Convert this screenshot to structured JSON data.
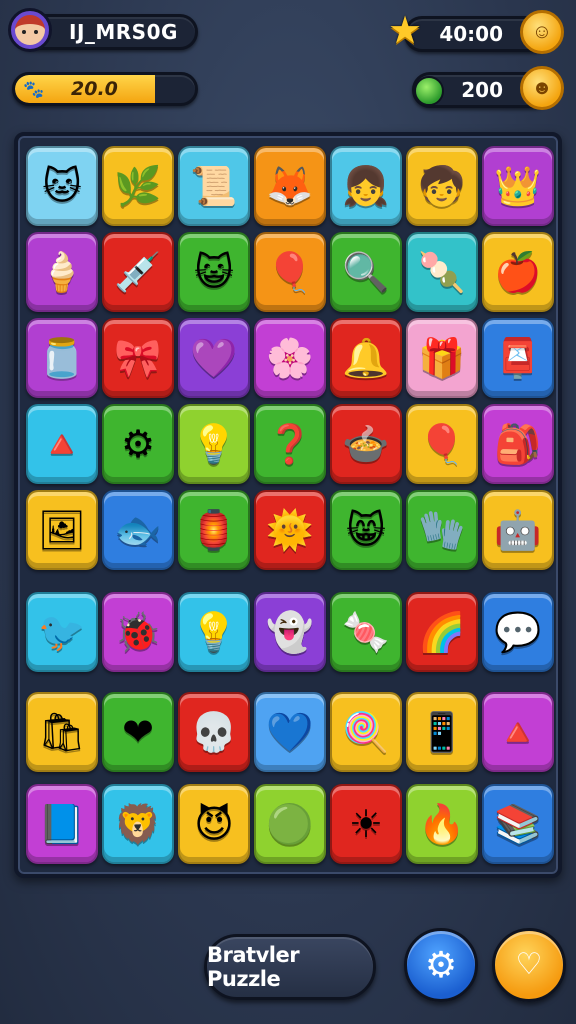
{
  "hud": {
    "player_name": "IJ_MRS0G",
    "energy_value": "20.0",
    "energy_fill": 0.75,
    "coins_value": "40:00",
    "gems_value": "200"
  },
  "footer": {
    "title_button": "Bratvler Puzzle",
    "settings_icon": "gear-icon",
    "hint_icon": "tooth-icon"
  },
  "board": {
    "rows": [
      [
        {
          "name": "tile-cat-king",
          "color": "#7fd3f2",
          "glyph": "🐱"
        },
        {
          "name": "tile-leaf",
          "color": "#f7c01f",
          "glyph": "🌿"
        },
        {
          "name": "tile-scroll",
          "color": "#4fc7e8",
          "glyph": "📜"
        },
        {
          "name": "tile-fox-warrior",
          "color": "#f59416",
          "glyph": "🦊"
        },
        {
          "name": "tile-blonde-girl",
          "color": "#4fc7e8",
          "glyph": "👧"
        },
        {
          "name": "tile-red-hood-girl",
          "color": "#f7c01f",
          "glyph": "🧒"
        },
        {
          "name": "tile-crown",
          "color": "#b13fd1",
          "glyph": "👑"
        }
      ],
      [
        {
          "name": "tile-ice-cream",
          "color": "#b13fd1",
          "glyph": "🍦"
        },
        {
          "name": "tile-syringe",
          "color": "#e0261f",
          "glyph": "💉"
        },
        {
          "name": "tile-red-cat",
          "color": "#3fb52f",
          "glyph": "😺"
        },
        {
          "name": "tile-balloon",
          "color": "#f59416",
          "glyph": "🎈"
        },
        {
          "name": "tile-magnifier",
          "color": "#3fb52f",
          "glyph": "🔍"
        },
        {
          "name": "tile-torch",
          "color": "#33c2c9",
          "glyph": "🍡"
        },
        {
          "name": "tile-apples",
          "color": "#f7c01f",
          "glyph": "🍎"
        }
      ],
      [
        {
          "name": "tile-jar",
          "color": "#b13fd1",
          "glyph": "🫙"
        },
        {
          "name": "tile-balloon-purple",
          "color": "#e0261f",
          "glyph": "🎀"
        },
        {
          "name": "tile-heart-wand",
          "color": "#8b3fd6",
          "glyph": "💜"
        },
        {
          "name": "tile-purple-flower",
          "color": "#c23fd4",
          "glyph": "🌸"
        },
        {
          "name": "tile-lamp",
          "color": "#e0261f",
          "glyph": "🔔"
        },
        {
          "name": "tile-gift",
          "color": "#f3a4d0",
          "glyph": "🎁"
        },
        {
          "name": "tile-mailbox",
          "color": "#2f7ee0",
          "glyph": "📮"
        }
      ],
      [
        {
          "name": "tile-pyramid",
          "color": "#33c2e9",
          "glyph": "🔺"
        },
        {
          "name": "tile-gear-bug",
          "color": "#3fb52f",
          "glyph": "⚙"
        },
        {
          "name": "tile-lightbulb",
          "color": "#8fd22f",
          "glyph": "💡"
        },
        {
          "name": "tile-question",
          "color": "#3fb52f",
          "glyph": "❓"
        },
        {
          "name": "tile-pot",
          "color": "#e0261f",
          "glyph": "🍲"
        },
        {
          "name": "tile-red-balloon",
          "color": "#f7c01f",
          "glyph": "🎈"
        },
        {
          "name": "tile-backpack",
          "color": "#c23fd4",
          "glyph": "🎒"
        }
      ],
      [
        {
          "name": "tile-frame",
          "color": "#f7c01f",
          "glyph": "🖼"
        },
        {
          "name": "tile-green-fish",
          "color": "#2f7ee0",
          "glyph": "🐟"
        },
        {
          "name": "tile-lantern",
          "color": "#3fb52f",
          "glyph": "🏮"
        },
        {
          "name": "tile-sun-blob",
          "color": "#e0261f",
          "glyph": "🌞"
        },
        {
          "name": "tile-yellow-cat",
          "color": "#3fb52f",
          "glyph": "😸"
        },
        {
          "name": "tile-mitten",
          "color": "#3fb52f",
          "glyph": "🧤"
        },
        {
          "name": "tile-robot",
          "color": "#f7c01f",
          "glyph": "🤖"
        }
      ],
      [
        {
          "name": "tile-bird",
          "color": "#33c2e9",
          "glyph": "🐦"
        },
        {
          "name": "tile-beetle",
          "color": "#c23fd4",
          "glyph": "🐞"
        },
        {
          "name": "tile-bulb",
          "color": "#33c2e9",
          "glyph": "💡"
        },
        {
          "name": "tile-ghost",
          "color": "#8b3fd6",
          "glyph": "👻"
        },
        {
          "name": "tile-candy",
          "color": "#3fb52f",
          "glyph": "🍬"
        },
        {
          "name": "tile-rainbow-frame",
          "color": "#e0261f",
          "glyph": "🌈"
        },
        {
          "name": "tile-chat-bubble",
          "color": "#2f7ee0",
          "glyph": "💬"
        }
      ],
      [
        {
          "name": "tile-bag",
          "color": "#f7c01f",
          "glyph": "🛍"
        },
        {
          "name": "tile-heart-stick",
          "color": "#3fb52f",
          "glyph": "❤"
        },
        {
          "name": "tile-skull",
          "color": "#e0261f",
          "glyph": "💀"
        },
        {
          "name": "tile-blue-heart",
          "color": "#4fa3f2",
          "glyph": "💙"
        },
        {
          "name": "tile-crossed-candy",
          "color": "#f7c01f",
          "glyph": "🍭"
        },
        {
          "name": "tile-phone",
          "color": "#f7c01f",
          "glyph": "📱"
        },
        {
          "name": "tile-rainbow-triangle",
          "color": "#c23fd4",
          "glyph": "🔺"
        }
      ],
      [
        {
          "name": "tile-book-pen",
          "color": "#c23fd4",
          "glyph": "📘"
        },
        {
          "name": "tile-lion",
          "color": "#33c2e9",
          "glyph": "🦁"
        },
        {
          "name": "tile-devil-cat",
          "color": "#f7c01f",
          "glyph": "😈"
        },
        {
          "name": "tile-green-sun",
          "color": "#8fd22f",
          "glyph": "🟢"
        },
        {
          "name": "tile-red-sun",
          "color": "#e0261f",
          "glyph": "☀"
        },
        {
          "name": "tile-flame-frame",
          "color": "#8fd22f",
          "glyph": "🔥"
        },
        {
          "name": "tile-stack",
          "color": "#2f7ee0",
          "glyph": "📚"
        }
      ]
    ]
  }
}
